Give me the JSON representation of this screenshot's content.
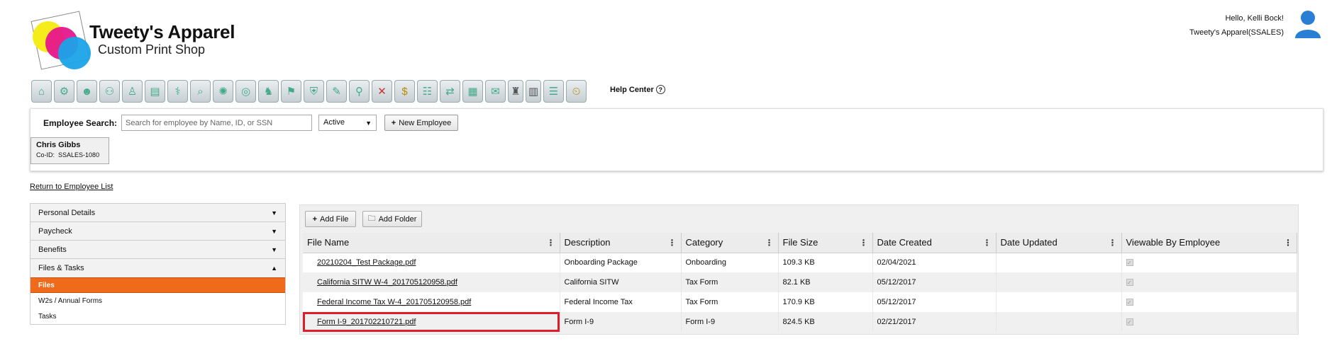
{
  "brand": {
    "title": "Tweety's Apparel",
    "subtitle": "Custom Print Shop"
  },
  "user": {
    "greeting": "Hello, Kelli Bock!",
    "company": "Tweety's Apparel(SSALES)"
  },
  "toolbar": {
    "icons": [
      "home-icon",
      "payroll-icon",
      "team-icon",
      "org-chart-icon",
      "employee-tree-icon",
      "report-icon",
      "benefits-icon",
      "analytics-icon",
      "settings-icon",
      "target-icon",
      "hr-icon",
      "onboarding-icon",
      "security-icon",
      "compliance-icon",
      "review-icon",
      "remove-icon",
      "money-icon",
      "groups-icon",
      "transfer-icon",
      "schedule-icon",
      "documents-icon",
      "gift-icon",
      "file-icon",
      "directory-icon",
      "time-off-icon"
    ],
    "help_label": "Help Center"
  },
  "search": {
    "label": "Employee Search:",
    "placeholder": "Search for employee by Name, ID, or SSN",
    "status_value": "Active",
    "new_employee_label": "New Employee"
  },
  "employee": {
    "name": "Chris Gibbs",
    "coid_label": "Co-ID:",
    "coid": "SSALES-1080"
  },
  "return_link": "Return to Employee List",
  "nav": {
    "sections": [
      {
        "label": "Personal Details",
        "expanded": false
      },
      {
        "label": "Paycheck",
        "expanded": false
      },
      {
        "label": "Benefits",
        "expanded": false
      },
      {
        "label": "Files & Tasks",
        "expanded": true
      }
    ],
    "sub_items": [
      {
        "label": "Files",
        "active": true
      },
      {
        "label": "W2s / Annual Forms",
        "active": false
      },
      {
        "label": "Tasks",
        "active": false
      }
    ]
  },
  "files": {
    "add_file_label": "Add File",
    "add_folder_label": "Add Folder",
    "columns": [
      "File Name",
      "Description",
      "Category",
      "File Size",
      "Date Created",
      "Date Updated",
      "Viewable By Employee"
    ],
    "rows": [
      {
        "name": "20210204_Test Package.pdf",
        "description": "Onboarding Package",
        "category": "Onboarding",
        "size": "109.3 KB",
        "created": "02/04/2021",
        "updated": "",
        "viewable": true
      },
      {
        "name": "California SITW W-4_201705120958.pdf",
        "description": "California SITW",
        "category": "Tax Form",
        "size": "82.1 KB",
        "created": "05/12/2017",
        "updated": "",
        "viewable": true
      },
      {
        "name": "Federal Income Tax W-4_201705120958.pdf",
        "description": "Federal Income Tax",
        "category": "Tax Form",
        "size": "170.9 KB",
        "created": "05/12/2017",
        "updated": "",
        "viewable": true
      },
      {
        "name": "Form I-9_201702210721.pdf",
        "description": "Form I-9",
        "category": "Form I-9",
        "size": "824.5 KB",
        "created": "02/21/2017",
        "updated": "",
        "viewable": true
      }
    ]
  }
}
